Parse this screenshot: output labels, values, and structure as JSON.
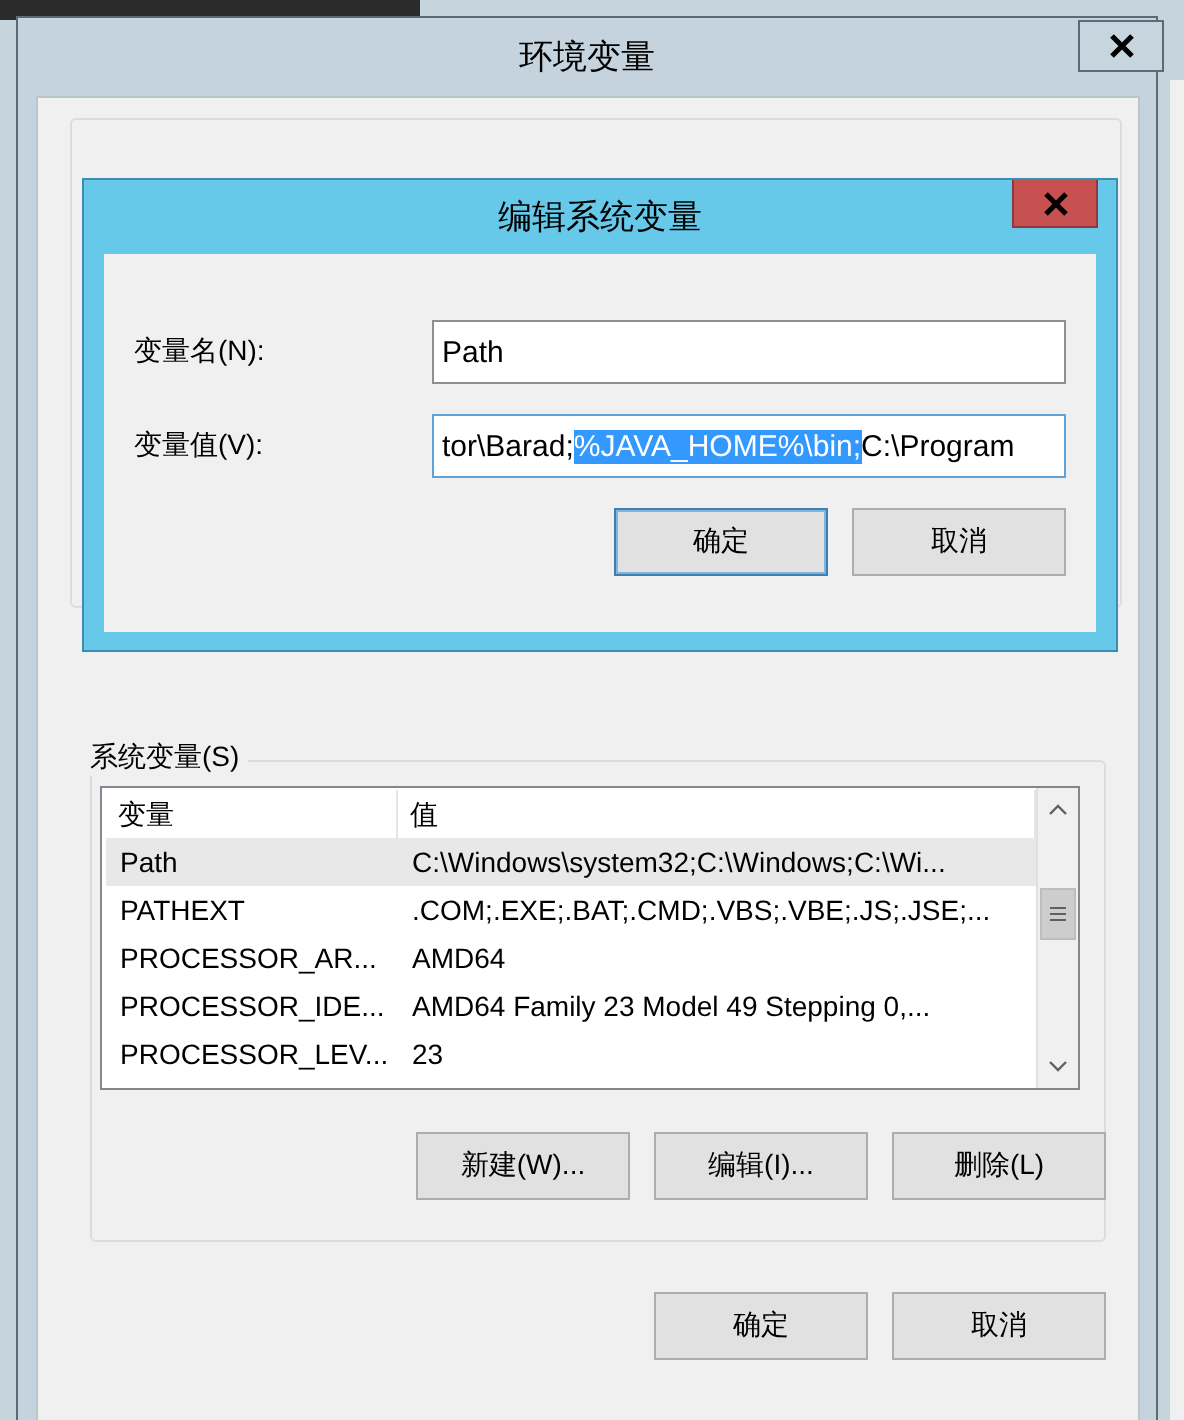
{
  "window": {
    "title": "环境变量"
  },
  "edit_dialog": {
    "title": "编辑系统变量",
    "fields": [
      {
        "label": "变量名(N):",
        "segments": [
          {
            "text": "Path",
            "selected": false
          }
        ]
      },
      {
        "label": "变量值(V):",
        "segments": [
          {
            "text": "tor\\Barad;",
            "selected": false
          },
          {
            "text": "%JAVA_HOME%\\bin;",
            "selected": true
          },
          {
            "text": "C:\\Program",
            "selected": false
          }
        ]
      }
    ],
    "buttons": [
      "确定",
      "取消"
    ]
  },
  "system_variables": {
    "title": "系统变量(S)",
    "columns": [
      "变量",
      "值"
    ],
    "rows": [
      {
        "name": "Path",
        "value": "C:\\Windows\\system32;C:\\Windows;C:\\Wi...",
        "selected": true
      },
      {
        "name": "PATHEXT",
        "value": ".COM;.EXE;.BAT;.CMD;.VBS;.VBE;.JS;.JSE;...",
        "selected": false
      },
      {
        "name": "PROCESSOR_AR...",
        "value": "AMD64",
        "selected": false
      },
      {
        "name": "PROCESSOR_IDE...",
        "value": "AMD64 Family 23 Model 49 Stepping 0,...",
        "selected": false
      },
      {
        "name": "PROCESSOR_LEV...",
        "value": "23",
        "selected": false
      }
    ],
    "buttons": [
      "新建(W)...",
      "编辑(I)...",
      "删除(L)"
    ]
  },
  "buttons": [
    "确定",
    "取消"
  ]
}
